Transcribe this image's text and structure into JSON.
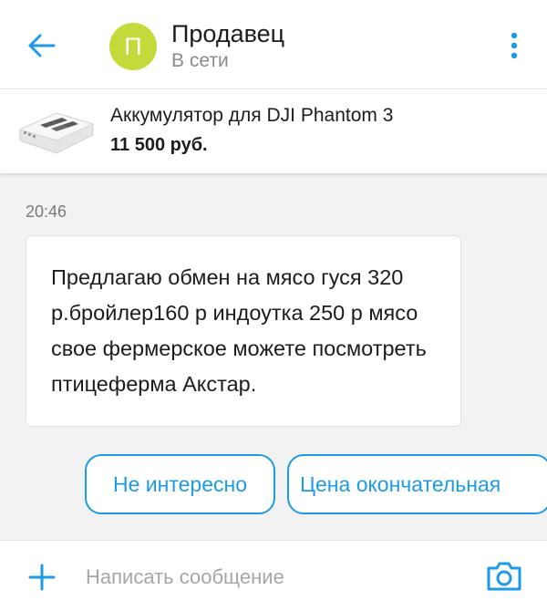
{
  "colors": {
    "accent": "#1e9be6",
    "avatar_bg": "#c4d93a",
    "background": "#f2f2f2"
  },
  "header": {
    "back_icon": "arrow-left-icon",
    "avatar_letter": "П",
    "seller_name": "Продавец",
    "seller_status": "В сети",
    "menu_icon": "more-vertical-icon"
  },
  "product": {
    "thumbnail": "battery-image",
    "title": "Аккумулятор для DJI Phantom 3",
    "price": "11 500 руб."
  },
  "messages": [
    {
      "time": "20:46",
      "text": "Предлагаю обмен на мясо гуся 320 р.бройлер160 р индоутка 250 р мясо свое фермерское можете посмотреть птицеферма Акстар."
    }
  ],
  "quick_replies": [
    {
      "label": "Не интересно"
    },
    {
      "label": "Цена окончательная"
    }
  ],
  "composer": {
    "add_icon": "plus-icon",
    "placeholder": "Написать сообщение",
    "value": "",
    "camera_icon": "camera-icon"
  }
}
